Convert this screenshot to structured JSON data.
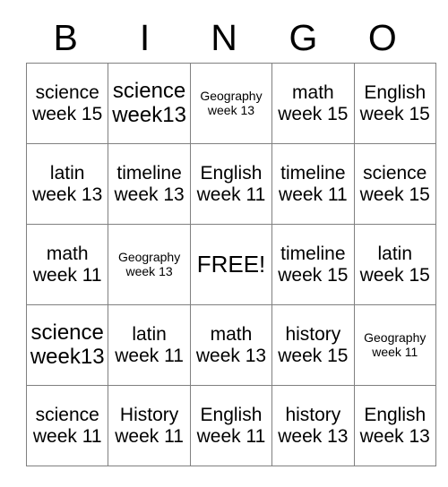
{
  "card": {
    "title": "BINGO",
    "headers": [
      "B",
      "I",
      "N",
      "G",
      "O"
    ],
    "rows": [
      [
        {
          "text": "science week 15",
          "size": "normal"
        },
        {
          "text": "science week13",
          "size": "large"
        },
        {
          "text": "Geography week 13",
          "size": "small"
        },
        {
          "text": "math week 15",
          "size": "normal"
        },
        {
          "text": "English week 15",
          "size": "normal"
        }
      ],
      [
        {
          "text": "latin week 13",
          "size": "normal"
        },
        {
          "text": "timeline week 13",
          "size": "normal"
        },
        {
          "text": "English week 11",
          "size": "normal"
        },
        {
          "text": "timeline week 11",
          "size": "normal"
        },
        {
          "text": "science week 15",
          "size": "normal"
        }
      ],
      [
        {
          "text": "math week 11",
          "size": "normal"
        },
        {
          "text": "Geography week 13",
          "size": "small"
        },
        {
          "text": "FREE!",
          "size": "free"
        },
        {
          "text": "timeline week 15",
          "size": "normal"
        },
        {
          "text": "latin week 15",
          "size": "normal"
        }
      ],
      [
        {
          "text": "science week13",
          "size": "large"
        },
        {
          "text": "latin week 11",
          "size": "normal"
        },
        {
          "text": "math week 13",
          "size": "normal"
        },
        {
          "text": "history week 15",
          "size": "normal"
        },
        {
          "text": "Geography week 11",
          "size": "small"
        }
      ],
      [
        {
          "text": "science week 11",
          "size": "normal"
        },
        {
          "text": "History week 11",
          "size": "normal"
        },
        {
          "text": "English week 11",
          "size": "normal"
        },
        {
          "text": "history week 13",
          "size": "normal"
        },
        {
          "text": "English week 13",
          "size": "normal"
        }
      ]
    ]
  },
  "colors": {
    "border": "#808080",
    "text": "#000000",
    "background": "#ffffff"
  }
}
